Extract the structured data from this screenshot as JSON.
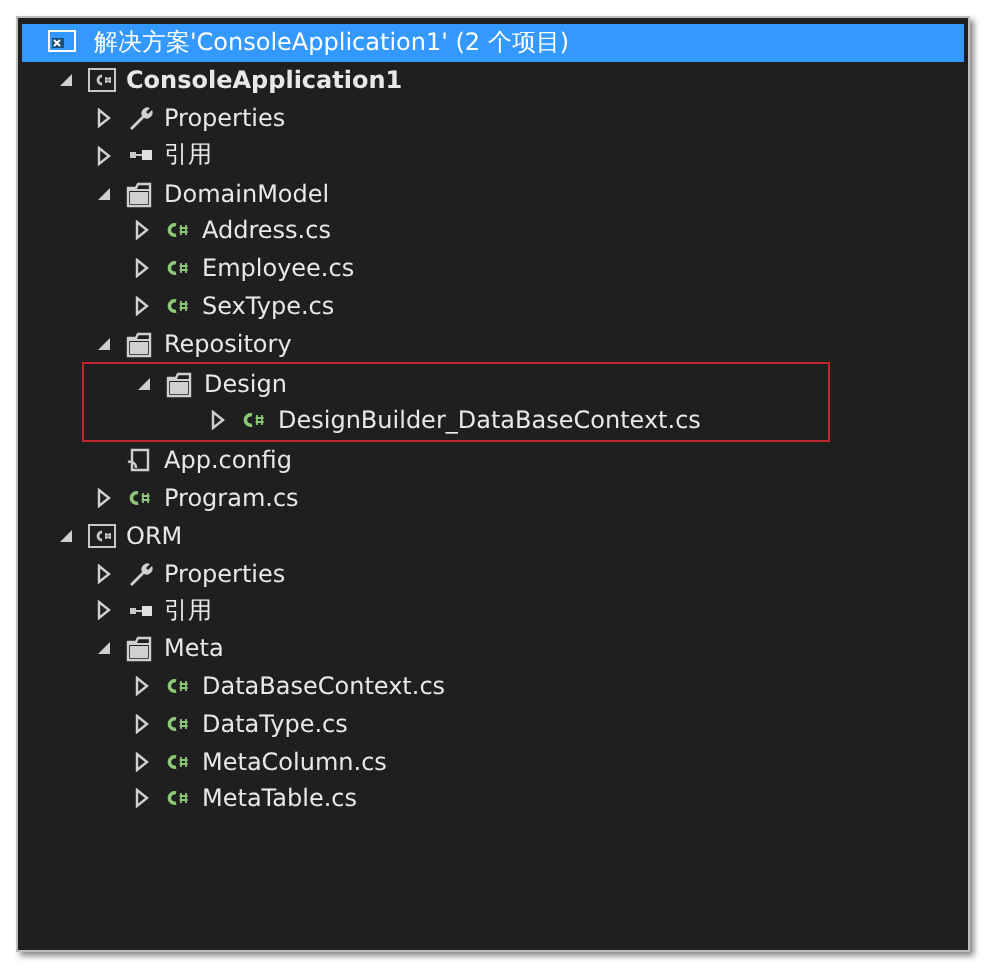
{
  "solution": {
    "title": "解决方案'ConsoleApplication1' (2 个项目)",
    "selected": true
  },
  "tree": [
    {
      "kind": "project",
      "label": "ConsoleApplication1",
      "bold": true,
      "expanded": true,
      "children": [
        {
          "kind": "properties",
          "label": "Properties",
          "expanded": false
        },
        {
          "kind": "references",
          "label": "引用",
          "expanded": false
        },
        {
          "kind": "folder",
          "label": "DomainModel",
          "expanded": true,
          "children": [
            {
              "kind": "cs",
              "label": "Address.cs",
              "expanded": false
            },
            {
              "kind": "cs",
              "label": "Employee.cs",
              "expanded": false
            },
            {
              "kind": "cs",
              "label": "SexType.cs",
              "expanded": false
            }
          ]
        },
        {
          "kind": "folder",
          "label": "Repository",
          "expanded": true,
          "children": [
            {
              "kind": "folder",
              "label": "Design",
              "expanded": true,
              "highlighted": true,
              "children": [
                {
                  "kind": "cs",
                  "label": "DesignBuilder_DataBaseContext.cs",
                  "expanded": false
                }
              ]
            }
          ]
        },
        {
          "kind": "config",
          "label": "App.config"
        },
        {
          "kind": "cs",
          "label": "Program.cs",
          "expanded": false
        }
      ]
    },
    {
      "kind": "project",
      "label": "ORM",
      "bold": false,
      "expanded": true,
      "children": [
        {
          "kind": "properties",
          "label": "Properties",
          "expanded": false
        },
        {
          "kind": "references",
          "label": "引用",
          "expanded": false
        },
        {
          "kind": "folder",
          "label": "Meta",
          "expanded": true,
          "children": [
            {
              "kind": "cs",
              "label": "DataBaseContext.cs",
              "expanded": false
            },
            {
              "kind": "cs",
              "label": "DataType.cs",
              "expanded": false
            },
            {
              "kind": "cs",
              "label": "MetaColumn.cs",
              "expanded": false
            },
            {
              "kind": "cs",
              "label": "MetaTable.cs",
              "expanded": false
            }
          ]
        }
      ]
    }
  ]
}
